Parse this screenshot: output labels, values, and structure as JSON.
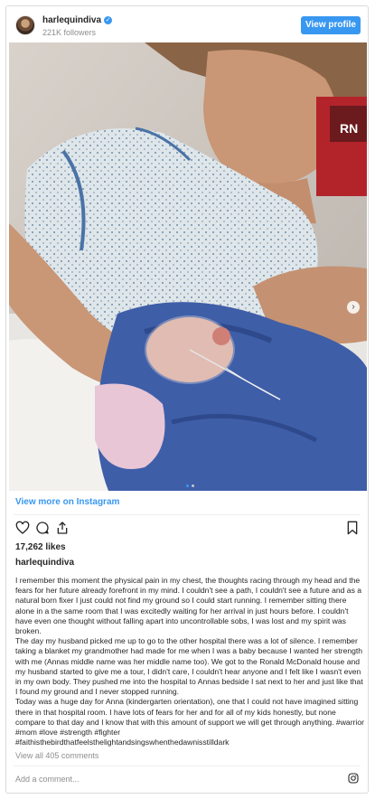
{
  "header": {
    "username": "harlequindiva",
    "followers": "221K followers",
    "view_profile_label": "View profile"
  },
  "photo": {
    "badge_text": "RN",
    "slide_count": 2,
    "active_slide": 1
  },
  "view_more_label": "View more on Instagram",
  "likes": "17,262 likes",
  "caption": {
    "username": "harlequindiva",
    "text": "I remember this moment the physical pain in my chest, the thoughts racing through my head and the fears for her future already forefront in my mind. I couldn't see a path, I couldn't see a future and as a natural born fixer I just could not find my ground so I could start running. I remember sitting there alone in a the same room that I was excitedly waiting for her arrival in just hours before. I couldn't have even one thought without falling apart into uncontrollable sobs, I was lost and my spirit was broken.\nThe day my husband picked me up to go to the other hospital there was a lot of silence. I remember taking a blanket my grandmother had made for me when I was a baby because I wanted her strength with me (Annas middle name was her middle name too). We got to the Ronald McDonald house and my husband started to give me a tour, I didn't care, I couldn't hear anyone and I felt like I wasn't even in my own body. They pushed me into the hospital to Annas bedside I sat next to her and just like that I found my ground and I never stopped running.\nToday was a huge day for Anna (kindergarten orientation), one that I could not have imagined sitting there in that hospital room. I have lots of fears for her and for all of my kids honestly, but none compare to that day and I know that with this amount of support we will get through anything. #warrior #mom #love #strength #fighter\n#faithisthebirdthatfeelsthelightandsingswhenthedawnisstilldark"
  },
  "view_comments_label": "View all 405 comments",
  "comment_placeholder": "Add a comment...",
  "icons": {
    "heart": "heart-icon",
    "comment": "comment-icon",
    "share": "share-icon",
    "bookmark": "bookmark-icon",
    "instagram": "instagram-icon",
    "verified": "verified-badge-icon"
  },
  "colors": {
    "accent": "#3897f0",
    "muted": "#8e8e8e",
    "text": "#262626"
  }
}
